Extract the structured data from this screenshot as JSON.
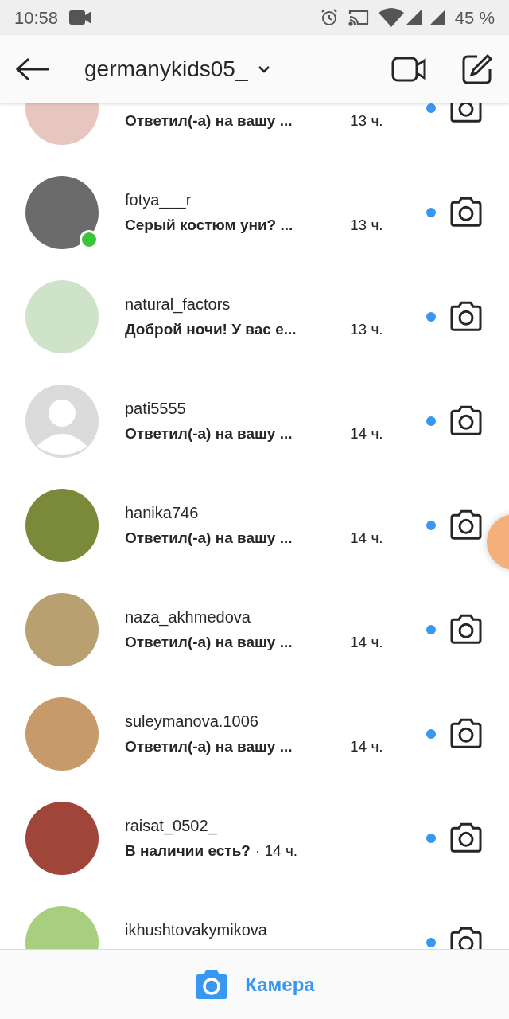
{
  "status_bar": {
    "time": "10:58",
    "battery": "45 %"
  },
  "header": {
    "account": "germanykids05_"
  },
  "threads": [
    {
      "message": "Ответил(-а) на вашу ...",
      "time": "13 ч.",
      "kind": "columns",
      "unread": true,
      "online": false
    },
    {
      "username": "fotya___r",
      "message": "Серый костюм уни? ...",
      "time": "13 ч.",
      "kind": "columns",
      "unread": true,
      "online": true
    },
    {
      "username": "natural_factors",
      "message": "Доброй ночи! У вас е...",
      "time": "13 ч.",
      "kind": "columns",
      "unread": true,
      "online": false
    },
    {
      "username": "pati5555",
      "message": "Ответил(-а) на вашу ...",
      "time": "14 ч.",
      "kind": "columns",
      "unread": true,
      "online": false,
      "default_avatar": true
    },
    {
      "username": "hanika746",
      "message": "Ответил(-а) на вашу ...",
      "time": "14 ч.",
      "kind": "columns",
      "unread": true,
      "online": false
    },
    {
      "username": "naza_akhmedova",
      "message": "Ответил(-а) на вашу ...",
      "time": "14 ч.",
      "kind": "columns",
      "unread": true,
      "online": false
    },
    {
      "username": "suleymanova.1006",
      "message": "Ответил(-а) на вашу ...",
      "time": "14 ч.",
      "kind": "columns",
      "unread": true,
      "online": false
    },
    {
      "username": "raisat_0502_",
      "message": "В наличии есть?",
      "time": "· 14 ч.",
      "kind": "inline",
      "unread": true,
      "online": false
    },
    {
      "username": "ikhushtovakymikova",
      "unread": true,
      "online": false
    }
  ],
  "bottom_bar": {
    "label": "Камера"
  }
}
